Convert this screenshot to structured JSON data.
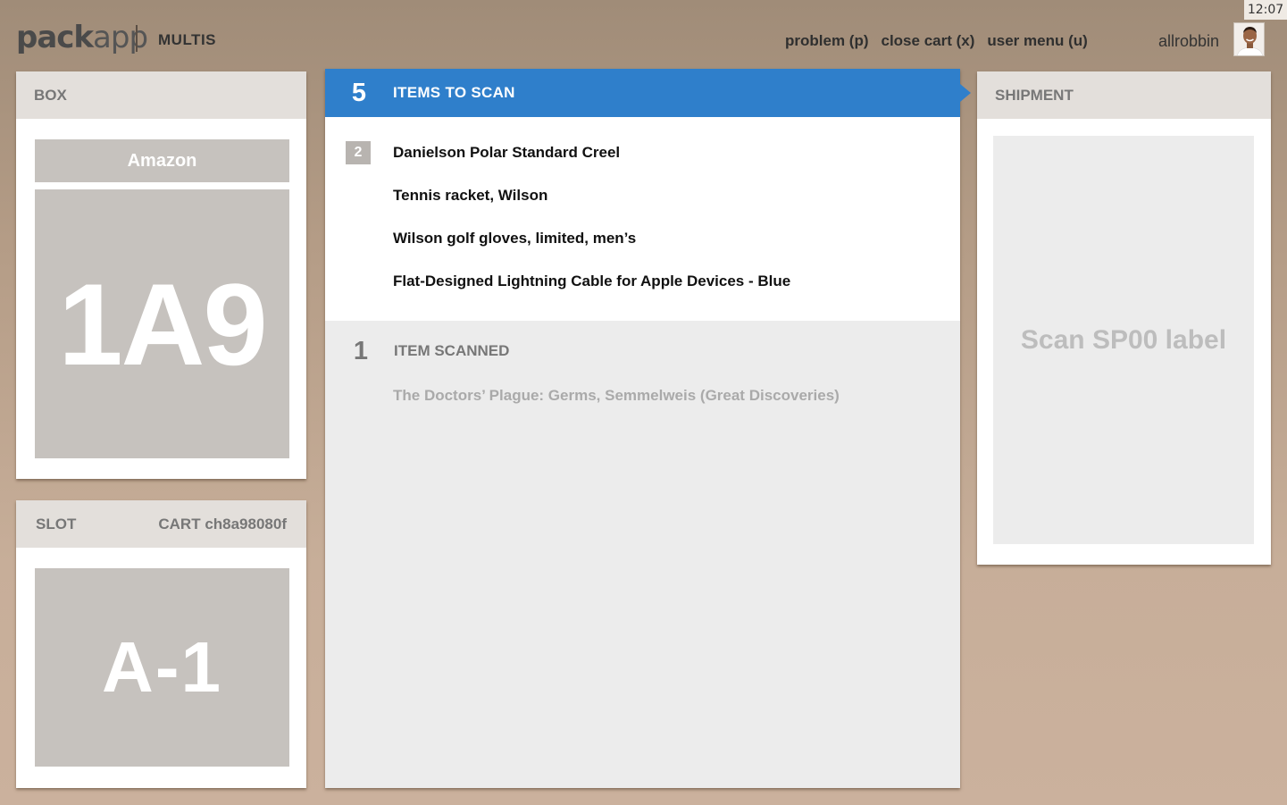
{
  "clock": "12:07",
  "header": {
    "logo_bold": "pack",
    "logo_light": "app",
    "mode": "MULTIS",
    "menu": [
      "problem (p)",
      "close cart (x)",
      "user menu (u)"
    ],
    "username": "allrobbin"
  },
  "box": {
    "title": "BOX",
    "carrier": "Amazon",
    "code": "1A9"
  },
  "slot": {
    "title": "SLOT",
    "cart": "CART ch8a98080f",
    "code": "A-1"
  },
  "to_scan": {
    "count": "5",
    "title": "ITEMS TO SCAN",
    "items": [
      {
        "qty": "2",
        "name": "Danielson Polar Standard Creel"
      },
      {
        "qty": "",
        "name": "Tennis racket, Wilson"
      },
      {
        "qty": "",
        "name": "Wilson golf gloves, limited, men’s"
      },
      {
        "qty": "",
        "name": "Flat-Designed Lightning Cable for Apple Devices - Blue"
      }
    ]
  },
  "scanned": {
    "count": "1",
    "title": "ITEM SCANNED",
    "items": [
      "The Doctors’ Plague: Germs, Semmelweis (Great Discoveries)"
    ]
  },
  "shipment": {
    "title": "SHIPMENT",
    "prompt": "Scan SP00 label"
  },
  "colors": {
    "accent": "#2f7fcb",
    "tile": "#c6c2be"
  }
}
